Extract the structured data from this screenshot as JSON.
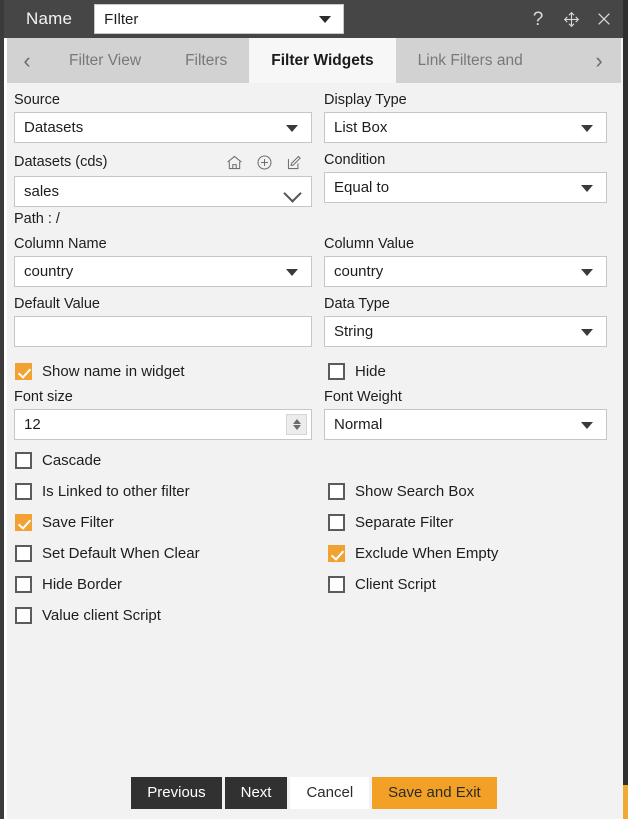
{
  "titlebar": {
    "name_label": "Name",
    "name_value": "FIlter",
    "help_icon": "question-mark-icon",
    "move_icon": "move-arrows-icon",
    "close_icon": "close-icon"
  },
  "tabs": {
    "prev_arrow": "‹",
    "next_arrow": "›",
    "items": [
      {
        "label": "Filter View",
        "active": false
      },
      {
        "label": "Filters",
        "active": false
      },
      {
        "label": "Filter Widgets",
        "active": true
      },
      {
        "label": "Link Filters and",
        "active": false
      }
    ]
  },
  "form": {
    "source": {
      "label": "Source",
      "value": "Datasets"
    },
    "display_type": {
      "label": "Display Type",
      "value": "List Box"
    },
    "datasets": {
      "label": "Datasets (cds)",
      "value": "sales"
    },
    "condition": {
      "label": "Condition",
      "value": "Equal to"
    },
    "path": "Path : /",
    "column_name": {
      "label": "Column Name",
      "value": "country"
    },
    "column_value": {
      "label": "Column Value",
      "value": "country"
    },
    "default_value": {
      "label": "Default Value",
      "value": ""
    },
    "data_type": {
      "label": "Data Type",
      "value": "String"
    },
    "font_size": {
      "label": "Font size",
      "value": "12"
    },
    "font_weight": {
      "label": "Font Weight",
      "value": "Normal"
    },
    "dataset_icons": [
      {
        "name": "home-icon"
      },
      {
        "name": "add-circle-icon"
      },
      {
        "name": "edit-icon"
      }
    ]
  },
  "checkboxes": {
    "show_name_in_widget": {
      "label": "Show name in widget",
      "checked": true
    },
    "hide": {
      "label": "Hide",
      "checked": false
    },
    "cascade": {
      "label": "Cascade",
      "checked": false
    },
    "is_linked_to_other_filter": {
      "label": "Is Linked to other filter",
      "checked": false
    },
    "show_search_box": {
      "label": "Show Search Box",
      "checked": false
    },
    "save_filter": {
      "label": "Save Filter",
      "checked": true
    },
    "separate_filter": {
      "label": "Separate Filter",
      "checked": false
    },
    "set_default_when_clear": {
      "label": "Set Default When Clear",
      "checked": false
    },
    "exclude_when_empty": {
      "label": "Exclude When Empty",
      "checked": true
    },
    "hide_border": {
      "label": "Hide Border",
      "checked": false
    },
    "client_script": {
      "label": "Client Script",
      "checked": false
    },
    "value_client_script": {
      "label": "Value client Script",
      "checked": false
    }
  },
  "footer": {
    "previous": "Previous",
    "next": "Next",
    "cancel": "Cancel",
    "save_and_exit": "Save and Exit"
  },
  "colors": {
    "accent": "#f2a126",
    "checkbox_checked": "#f2a233",
    "titlebar": "#464646",
    "tabstrip": "#d2d2d2",
    "body": "#f2f2f2",
    "button_dark": "#313131"
  }
}
